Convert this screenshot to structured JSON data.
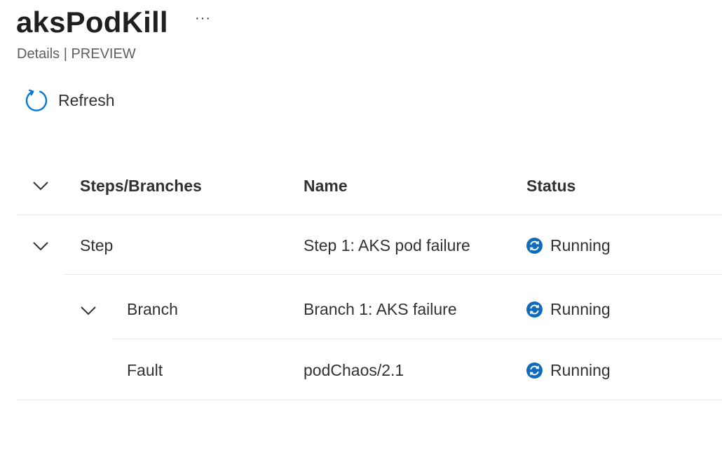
{
  "header": {
    "title": "aksPodKill",
    "more_label": "···",
    "subtitle": "Details | PREVIEW"
  },
  "toolbar": {
    "refresh_label": "Refresh",
    "refresh_icon": "refresh-icon"
  },
  "table": {
    "columns": [
      "Steps/Branches",
      "Name",
      "Status"
    ],
    "rows": [
      {
        "type": "Step",
        "name": "Step 1: AKS pod failure",
        "status": "Running",
        "expanded": true
      },
      {
        "type": "Branch",
        "name": "Branch 1: AKS failure",
        "status": "Running",
        "expanded": true
      },
      {
        "type": "Fault",
        "name": "podChaos/2.1",
        "status": "Running"
      }
    ]
  },
  "colors": {
    "accent": "#0078d4",
    "status_running": "#0f6cbd",
    "divider": "#edebe9",
    "text": "#323130",
    "subtext": "#605e5c"
  }
}
